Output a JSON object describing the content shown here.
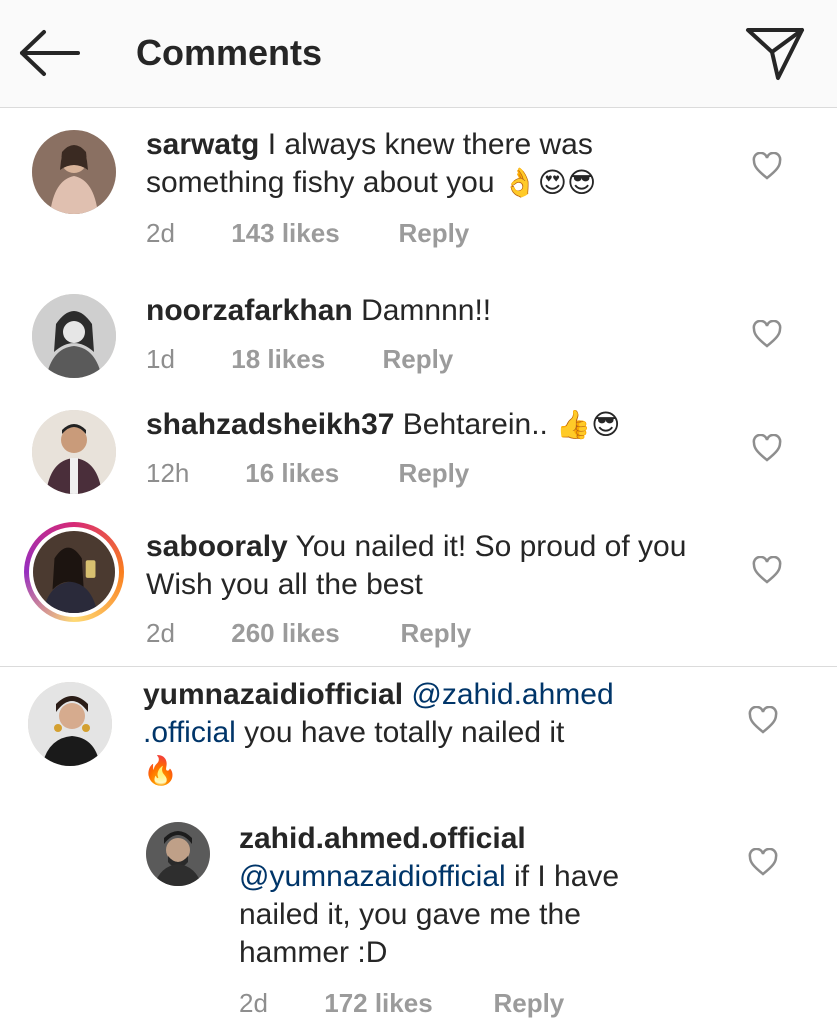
{
  "header": {
    "title": "Comments"
  },
  "comments": [
    {
      "username": "sarwatg",
      "text": "I always knew there was something fishy about you",
      "emoji": "👌😍😎",
      "time": "2d",
      "likes": "143 likes",
      "reply": "Reply"
    },
    {
      "username": "noorzafarkhan",
      "text": "Damnnn!!",
      "time": "1d",
      "likes": "18 likes",
      "reply": "Reply"
    },
    {
      "username": "shahzadsheikh37",
      "text": "Behtarein..",
      "emoji": "👍😎",
      "time": "12h",
      "likes": "16 likes",
      "reply": "Reply"
    },
    {
      "username": "sabooraly",
      "text_line1": "You nailed it! So proud of you",
      "text_line2": "Wish you all the best",
      "time": "2d",
      "likes": "260 likes",
      "reply": "Reply"
    },
    {
      "username": "yumnazaidiofficial",
      "mention_part1": "@zahid.ahmed",
      "mention_part2": ".official",
      "text": "you have totally nailed it",
      "emoji": "🔥"
    }
  ],
  "reply_comment": {
    "username": "zahid.ahmed.official",
    "mention": "@yumnazaidiofficial",
    "text_line1": "if I have",
    "text_line2": "nailed it, you gave me the",
    "text_line3": "hammer :D",
    "time": "2d",
    "likes": "172 likes",
    "reply": "Reply"
  }
}
